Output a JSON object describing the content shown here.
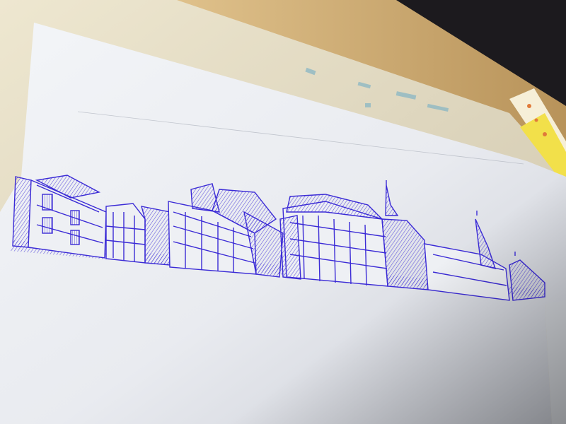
{
  "photo": {
    "subject": "ballpoint-pen-skyline-drawing",
    "colors": {
      "ink": "#3b2bd6",
      "ink_dark": "#1f128f",
      "paper": "#eef0f4",
      "paper_shadow": "#c9ccd4",
      "backing_board": "#e7ddc2",
      "cardboard": "#d9b77f",
      "desk_dark": "#1c1a1e",
      "pencil_yellow": "#f2e04a",
      "pencil_cream": "#f6efd8",
      "smudge_teal": "#8fb9c4"
    },
    "icons": [
      "pen-ink-skyline",
      "spire-icon",
      "pencil-icon"
    ]
  }
}
